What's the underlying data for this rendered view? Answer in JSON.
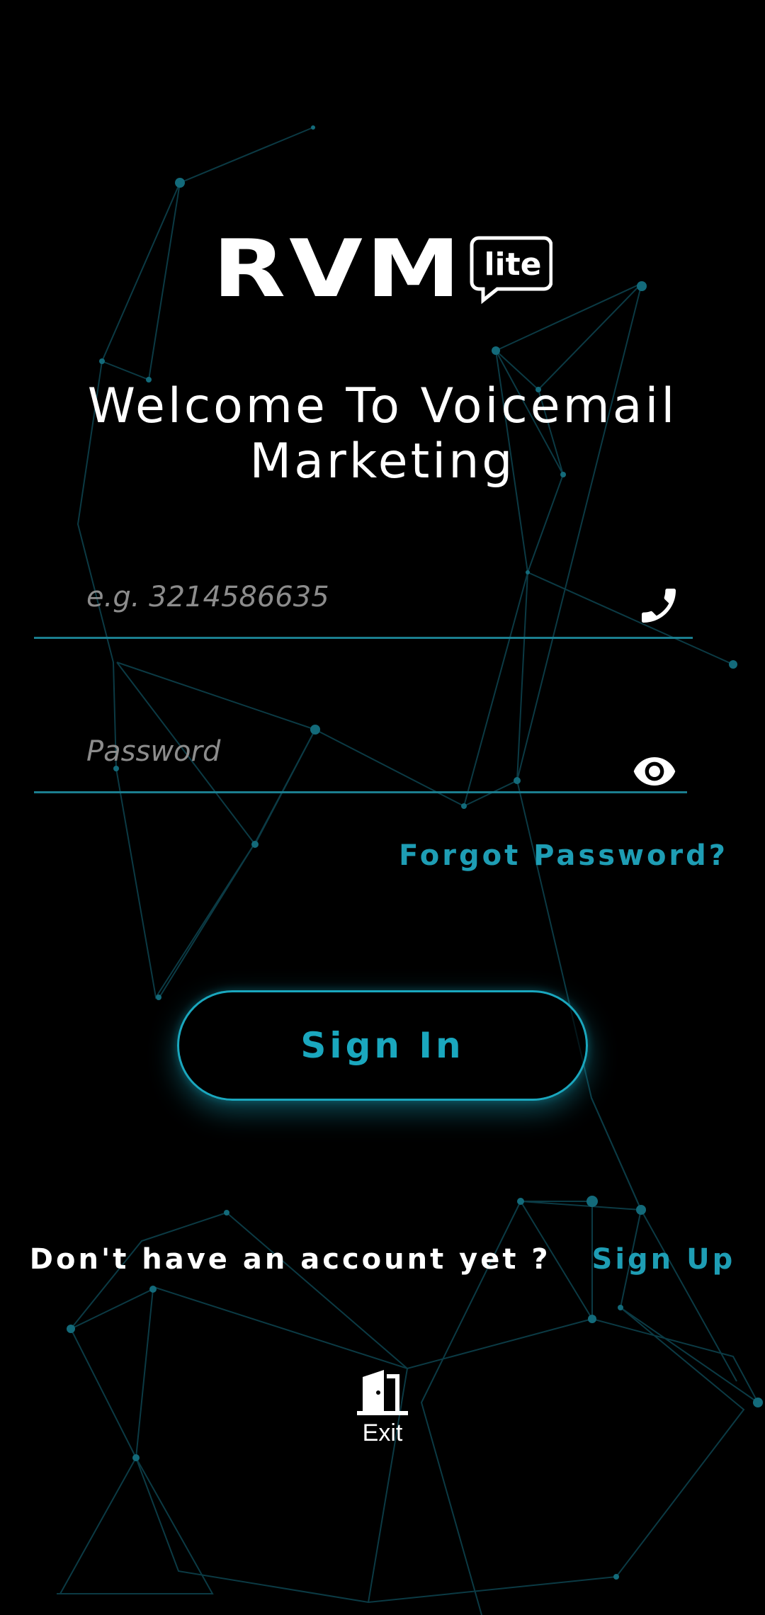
{
  "brand": {
    "logo_main": "RVM",
    "logo_badge": "lite"
  },
  "welcome": {
    "line1": "Welcome To Voicemail",
    "line2": "Marketing"
  },
  "phone_field": {
    "value": "",
    "placeholder": "e.g. 3214586635",
    "icon": "phone-icon"
  },
  "password_field": {
    "value": "",
    "placeholder": "Password",
    "icon": "eye-icon"
  },
  "forgot_password": "Forgot Password?",
  "sign_in_button": "Sign In",
  "signup": {
    "prompt": "Don't have an account yet ?",
    "link": "Sign Up"
  },
  "exit": {
    "label": "Exit",
    "icon": "door-icon"
  },
  "colors": {
    "accent": "#1e9db4",
    "background": "#000000",
    "text": "#ffffff",
    "placeholder": "#8c8c8c"
  }
}
